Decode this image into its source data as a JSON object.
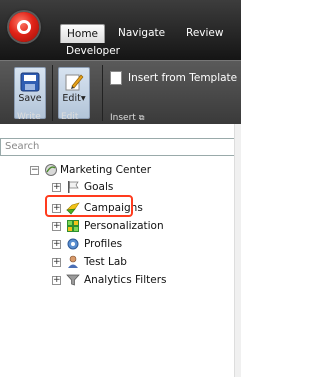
{
  "ribbon": {
    "tabs": [
      "Home",
      "Navigate",
      "Review",
      "Developer"
    ],
    "active_tab": "Home",
    "buttons": {
      "save": "Save",
      "edit": "Edit",
      "insert_from_template": "Insert from Template"
    },
    "groups": [
      "Write",
      "Edit",
      "Insert"
    ]
  },
  "search": {
    "placeholder": "Search"
  },
  "tree": {
    "root": "Marketing Center",
    "items": [
      "Goals",
      "Campaigns",
      "Personalization",
      "Profiles",
      "Test Lab",
      "Analytics Filters"
    ],
    "highlighted": "Campaigns"
  },
  "colors": {
    "highlight": "#ff3b1e",
    "ribbon_dark": "#2a2a2a"
  }
}
